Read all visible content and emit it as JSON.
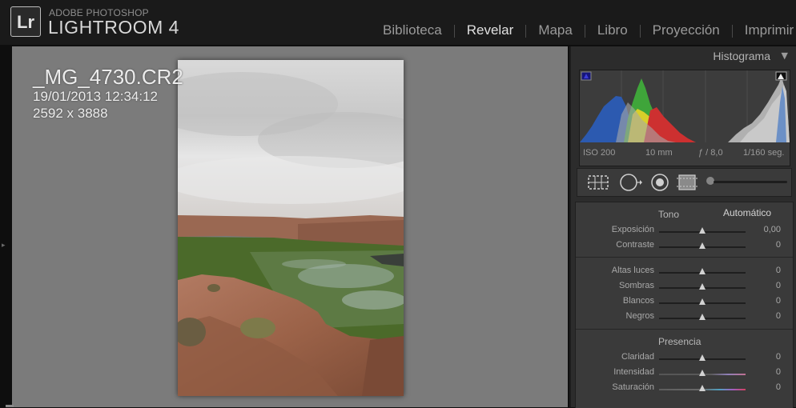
{
  "app": {
    "logo_text": "Lr",
    "brand_small": "ADOBE PHOTOSHOP",
    "brand_name": "LIGHTROOM 4"
  },
  "modules": [
    {
      "label": "Biblioteca",
      "active": false
    },
    {
      "label": "Revelar",
      "active": true
    },
    {
      "label": "Mapa",
      "active": false
    },
    {
      "label": "Libro",
      "active": false
    },
    {
      "label": "Proyección",
      "active": false
    },
    {
      "label": "Imprimir",
      "active": false
    }
  ],
  "photo_info": {
    "file_name": "_MG_4730.CR2",
    "date": "19/01/2013 12:34:12",
    "dimensions": "2592 x 3888"
  },
  "histogram": {
    "title": "Histograma",
    "iso": "ISO 200",
    "focal": "10 mm",
    "aperture": "ƒ / 8,0",
    "shutter": "1/160 seg."
  },
  "tools": [
    "crop-overlay-icon",
    "spot-removal-icon",
    "red-eye-icon",
    "graduated-filter-icon",
    "adjustment-brush-icon"
  ],
  "basic": {
    "tone_title": "Tono",
    "auto_label": "Automático",
    "presence_title": "Presencia",
    "sliders_tone": [
      {
        "label": "Exposición",
        "value": "0,00"
      },
      {
        "label": "Contraste",
        "value": "0"
      }
    ],
    "sliders_light": [
      {
        "label": "Altas luces",
        "value": "0"
      },
      {
        "label": "Sombras",
        "value": "0"
      },
      {
        "label": "Blancos",
        "value": "0"
      },
      {
        "label": "Negros",
        "value": "0"
      }
    ],
    "sliders_presence": [
      {
        "label": "Claridad",
        "value": "0"
      },
      {
        "label": "Intensidad",
        "value": "0"
      },
      {
        "label": "Saturación",
        "value": "0"
      }
    ]
  },
  "colors": {
    "background": "#7b7b7b",
    "panel": "#3a3a3a",
    "topbar": "#1a1a1a"
  }
}
